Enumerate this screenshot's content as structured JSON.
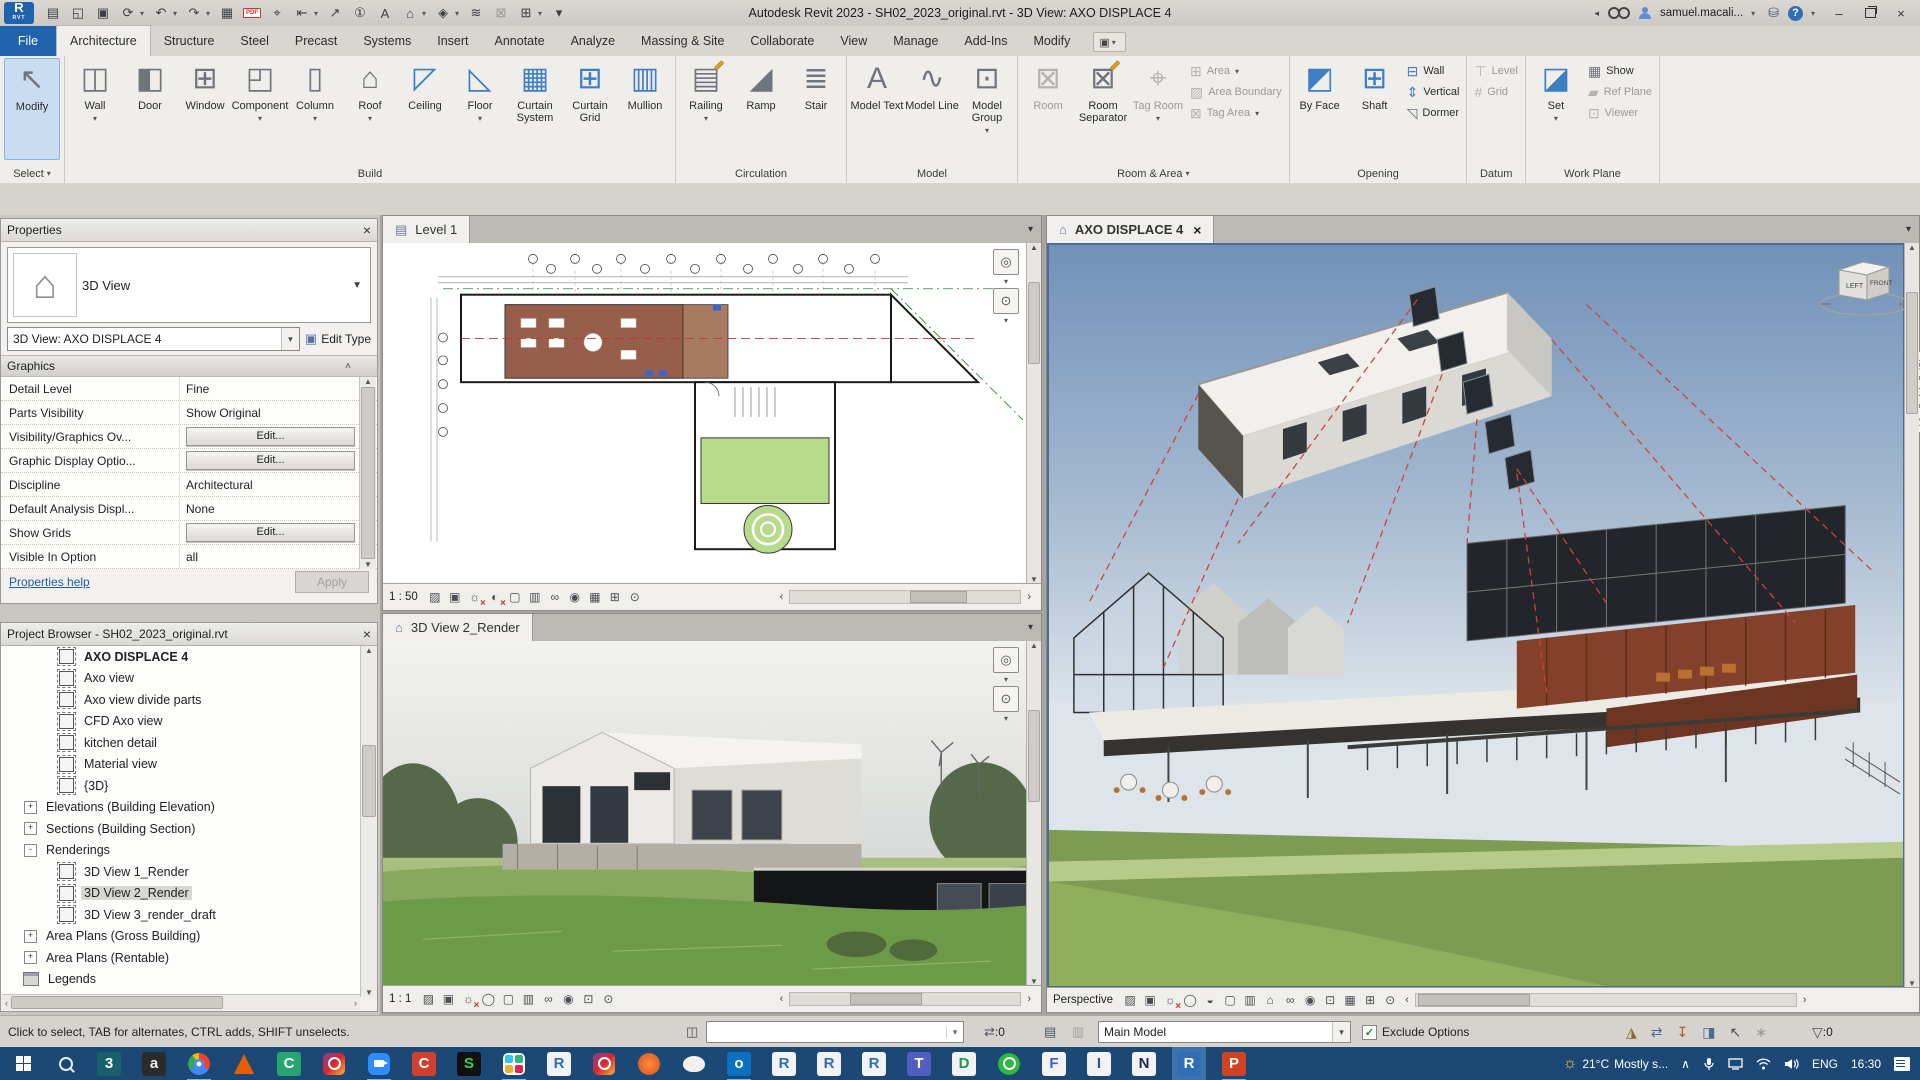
{
  "title_bar": {
    "title": "Autodesk Revit 2023 - SH02_2023_original.rvt - 3D View: AXO DISPLACE 4",
    "user": "samuel.macali...",
    "qat": [
      {
        "n": "file-properties-icon",
        "g": "▤"
      },
      {
        "n": "open-file-icon",
        "g": "◱"
      },
      {
        "n": "save-icon",
        "g": "▣"
      },
      {
        "n": "sync-with-central-icon",
        "g": "⟳",
        "a": 1
      },
      {
        "n": "undo-icon",
        "g": "↶",
        "a": 1
      },
      {
        "n": "redo-icon",
        "g": "↷",
        "a": 1
      },
      {
        "n": "print-icon",
        "g": "▦"
      },
      {
        "n": "export-pdf-icon",
        "g": "PDF",
        "pdf": 1
      },
      {
        "n": "measure-icon",
        "g": "⌖"
      },
      {
        "n": "aligned-dimension-icon",
        "g": "⇤",
        "a": 1
      },
      {
        "n": "detail-line-icon",
        "g": "↗"
      },
      {
        "n": "tag-by-category-icon",
        "g": "①"
      },
      {
        "n": "text-icon",
        "g": "A"
      },
      {
        "n": "default-3d-view-icon",
        "g": "⌂",
        "a": 1
      },
      {
        "n": "section-icon",
        "g": "◈",
        "a": 1
      },
      {
        "n": "thin-lines-icon",
        "g": "≋"
      },
      {
        "n": "close-inactive-windows-icon",
        "g": "⊠",
        "dis": 1
      },
      {
        "n": "switch-windows-icon",
        "g": "⊞",
        "a": 1
      },
      {
        "n": "customize-qat-icon",
        "g": "▾"
      }
    ]
  },
  "tabs": {
    "items": [
      "File",
      "Architecture",
      "Structure",
      "Steel",
      "Precast",
      "Systems",
      "Insert",
      "Annotate",
      "Analyze",
      "Massing & Site",
      "Collaborate",
      "View",
      "Manage",
      "Add-Ins",
      "Modify"
    ],
    "active_index": 1
  },
  "ribbon": {
    "select": {
      "modify": "Modify",
      "label": "Select"
    },
    "panels": [
      {
        "name": "Build",
        "buttons": [
          {
            "l": "Wall",
            "g": "◫",
            "a": 1
          },
          {
            "l": "Door",
            "g": "◧"
          },
          {
            "l": "Window",
            "g": "⊞"
          },
          {
            "l": "Component",
            "g": "◰",
            "a": 1
          },
          {
            "l": "Column",
            "g": "▯",
            "a": 1
          },
          {
            "l": "Roof",
            "g": "⌂",
            "a": 1
          },
          {
            "l": "Ceiling",
            "g": "◸",
            "blu": 1
          },
          {
            "l": "Floor",
            "g": "◺",
            "a": 1,
            "blu": 1
          },
          {
            "l": "Curtain System",
            "g": "▦",
            "blu": 1
          },
          {
            "l": "Curtain Grid",
            "g": "⊞",
            "blu": 1
          },
          {
            "l": "Mullion",
            "g": "▥",
            "blu": 1
          }
        ]
      },
      {
        "name": "Circulation",
        "buttons": [
          {
            "l": "Railing",
            "g": "▤",
            "a": 1,
            "pen": 1
          },
          {
            "l": "Ramp",
            "g": "◢"
          },
          {
            "l": "Stair",
            "g": "≣"
          }
        ]
      },
      {
        "name": "Model",
        "buttons": [
          {
            "l": "Model Text",
            "g": "A"
          },
          {
            "l": "Model Line",
            "g": "∿"
          },
          {
            "l": "Model Group",
            "g": "⊡",
            "a": 1
          }
        ]
      },
      {
        "name": "Room & Area",
        "arrow": 1,
        "buttons": [
          {
            "l": "Room",
            "g": "⊠",
            "dis": 1
          },
          {
            "l": "Room Separator",
            "g": "⊠",
            "pen": 1
          },
          {
            "l": "Tag Room",
            "g": "⌖",
            "dis": 1,
            "a": 1
          },
          {
            "l": "Area",
            "g": "⊞",
            "dis": 1,
            "a": 1,
            "s": 1
          },
          {
            "l": "Area Boundary",
            "g": "▨",
            "dis": 1,
            "s": 1
          },
          {
            "l": "Tag Area",
            "g": "⊠",
            "dis": 1,
            "a": 1,
            "s": 1
          }
        ]
      },
      {
        "name": "Opening",
        "buttons": [
          {
            "l": "By Face",
            "g": "◩",
            "blu": 1
          },
          {
            "l": "Shaft",
            "g": "⊞",
            "blu": 1
          },
          {
            "l": "Wall",
            "g": "⊟",
            "blu": 1,
            "s": 1
          },
          {
            "l": "Vertical",
            "g": "⇕",
            "blu": 1,
            "s": 1
          },
          {
            "l": "Dormer",
            "g": "◹",
            "s": 1
          }
        ]
      },
      {
        "name": "Datum",
        "buttons": [
          {
            "l": "Level",
            "g": "⊤",
            "dis": 1,
            "s": 1
          },
          {
            "l": "Grid",
            "g": "#",
            "dis": 1,
            "s": 1
          }
        ]
      },
      {
        "name": "Work Plane",
        "buttons": [
          {
            "l": "Set",
            "g": "◪",
            "a": 1,
            "blu": 1
          },
          {
            "l": "Show",
            "g": "▦",
            "s": 1
          },
          {
            "l": "Ref Plane",
            "g": "▰",
            "dis": 1,
            "s": 1
          },
          {
            "l": "Viewer",
            "g": "⊡",
            "dis": 1,
            "s": 1
          }
        ]
      }
    ]
  },
  "properties": {
    "header": "Properties",
    "type_name": "3D View",
    "instance": "3D View: AXO DISPLACE 4",
    "edit_type": "Edit Type",
    "section": "Graphics",
    "rows": [
      {
        "label": "Detail Level",
        "value": "Fine"
      },
      {
        "label": "Parts Visibility",
        "value": "Show Original"
      },
      {
        "label": "Visibility/Graphics Ov...",
        "value": "Edit...",
        "btn": 1
      },
      {
        "label": "Graphic Display Optio...",
        "value": "Edit...",
        "btn": 1
      },
      {
        "label": "Discipline",
        "value": "Architectural"
      },
      {
        "label": "Default Analysis Displ...",
        "value": "None"
      },
      {
        "label": "Show Grids",
        "value": "Edit...",
        "btn": 1
      },
      {
        "label": "Visible In Option",
        "value": "all"
      }
    ],
    "help": "Properties help",
    "apply": "Apply"
  },
  "project_browser": {
    "header": "Project Browser - SH02_2023_original.rvt",
    "items": [
      {
        "label": "AXO DISPLACE 4",
        "t": "view",
        "bold": 1
      },
      {
        "label": "Axo view",
        "t": "view"
      },
      {
        "label": "Axo view divide parts",
        "t": "view"
      },
      {
        "label": "CFD Axo view",
        "t": "view"
      },
      {
        "label": "kitchen detail",
        "t": "view"
      },
      {
        "label": "Material view",
        "t": "view"
      },
      {
        "label": "{3D}",
        "t": "view"
      },
      {
        "label": "Elevations (Building Elevation)",
        "t": "cat",
        "exp": "+"
      },
      {
        "label": "Sections (Building Section)",
        "t": "cat",
        "exp": "+"
      },
      {
        "label": "Renderings",
        "t": "cat",
        "exp": "-"
      },
      {
        "label": "3D View 1_Render",
        "t": "view"
      },
      {
        "label": "3D View 2_Render",
        "t": "view",
        "sel": 1
      },
      {
        "label": "3D View 3_render_draft",
        "t": "view"
      },
      {
        "label": "Area Plans (Gross Building)",
        "t": "cat",
        "exp": "+"
      },
      {
        "label": "Area Plans (Rentable)",
        "t": "cat",
        "exp": "+"
      },
      {
        "label": "Legends",
        "t": "leg"
      }
    ]
  },
  "views": {
    "plan": {
      "tab": "Level 1",
      "scale": "1 : 50",
      "vcb": [
        {
          "n": "detail-level-icon",
          "g": "▨"
        },
        {
          "n": "visual-style-icon",
          "g": "▣"
        },
        {
          "n": "sun-path-icon",
          "g": "☼",
          "off": 1
        },
        {
          "n": "shadows-icon",
          "g": "◐",
          "off": 1
        },
        {
          "n": "crop-view-icon",
          "g": "▢"
        },
        {
          "n": "show-crop-region-icon",
          "g": "▥"
        },
        {
          "n": "temporary-hide-isolate-icon",
          "g": "∞"
        },
        {
          "n": "reveal-hidden-elements-icon",
          "g": "◉"
        },
        {
          "n": "temporary-view-properties-icon",
          "g": "▦"
        },
        {
          "n": "worksharing-display-icon",
          "g": "⊞"
        },
        {
          "n": "reveal-constraints-icon",
          "g": "⊙"
        }
      ]
    },
    "render": {
      "tab": "3D View 2_Render",
      "scale": "1 : 1",
      "vcb": [
        {
          "n": "detail-level-icon",
          "g": "▨"
        },
        {
          "n": "visual-style-icon",
          "g": "▣"
        },
        {
          "n": "sun-path-icon",
          "g": "☼",
          "off": 1
        },
        {
          "n": "render-icon",
          "g": "◯"
        },
        {
          "n": "crop-view-icon",
          "g": "▢"
        },
        {
          "n": "show-crop-region-icon",
          "g": "▥"
        },
        {
          "n": "temporary-hide-isolate-icon",
          "g": "∞"
        },
        {
          "n": "reveal-hidden-elements-icon",
          "g": "◉"
        },
        {
          "n": "temporary-view-properties-icon",
          "g": "⊡"
        },
        {
          "n": "reveal-constraints-icon",
          "g": "⊙"
        }
      ]
    },
    "axo": {
      "tab": "AXO DISPLACE 4",
      "mode": "Perspective",
      "viewcube_left": "LEFT",
      "viewcube_front": "FRONT",
      "vcb": [
        {
          "n": "detail-level-icon",
          "g": "▨"
        },
        {
          "n": "visual-style-icon",
          "g": "▣"
        },
        {
          "n": "sun-path-icon",
          "g": "☼",
          "off": 1
        },
        {
          "n": "render-icon",
          "g": "◯"
        },
        {
          "n": "render-gallery-icon",
          "g": "◒"
        },
        {
          "n": "crop-view-icon",
          "g": "▢"
        },
        {
          "n": "show-crop-region-icon",
          "g": "▥"
        },
        {
          "n": "save-orientation-icon",
          "g": "⌂"
        },
        {
          "n": "temporary-hide-isolate-icon",
          "g": "∞"
        },
        {
          "n": "reveal-hidden-elements-icon",
          "g": "◉"
        },
        {
          "n": "temporary-view-properties-icon",
          "g": "⊡"
        },
        {
          "n": "worksharing-display-icon",
          "g": "▦"
        },
        {
          "n": "displaced-elements-icon",
          "g": "⊞"
        },
        {
          "n": "reveal-constraints-icon",
          "g": "⊙"
        }
      ]
    }
  },
  "status_bar": {
    "hint": "Click to select, TAB for alternates, CTRL adds, SHIFT unselects.",
    "editing_requests": ":0",
    "design_option": "Main Model",
    "exclude_options": "Exclude Options",
    "selection_count": ":0"
  },
  "taskbar": {
    "apps": [
      {
        "n": "app-3ds-max",
        "k": "sq",
        "l": "3",
        "bg": "#16616b",
        "fg": "#ffffff"
      },
      {
        "n": "app-dark-a",
        "k": "sq",
        "l": "a",
        "bg": "#2b2b2b",
        "fg": "#eeeeee"
      },
      {
        "n": "app-chrome",
        "k": "chrome",
        "running": 1
      },
      {
        "n": "app-vlc",
        "k": "vlc"
      },
      {
        "n": "app-camtasia",
        "k": "sq",
        "l": "C",
        "bg": "#27a56f",
        "fg": "#ffffff"
      },
      {
        "n": "app-clipchamp",
        "k": "grad"
      },
      {
        "n": "app-zoom",
        "k": "zoom",
        "running": 1
      },
      {
        "n": "app-ccleaner",
        "k": "sq",
        "l": "C",
        "bg": "#d33f2e",
        "fg": "#ffffff"
      },
      {
        "n": "app-s-black",
        "k": "sq",
        "l": "S",
        "bg": "#101010",
        "fg": "#39d353"
      },
      {
        "n": "app-slack",
        "k": "slack",
        "running": 1
      },
      {
        "n": "app-revit-white",
        "k": "sq",
        "l": "R",
        "bg": "#f2f2f2",
        "fg": "#2f6eb5"
      },
      {
        "n": "app-photos",
        "k": "grad"
      },
      {
        "n": "app-orange",
        "k": "orange"
      },
      {
        "n": "app-rhino",
        "k": "rhino"
      },
      {
        "n": "app-outlook",
        "k": "sq",
        "l": "o",
        "bg": "#0b6fc2",
        "fg": "#ffffff",
        "running": 1
      },
      {
        "n": "app-revit-2",
        "k": "sq",
        "l": "R",
        "bg": "#f2f2f2",
        "fg": "#2f6eb5"
      },
      {
        "n": "app-revit-3",
        "k": "sq",
        "l": "R",
        "bg": "#f2f2f2",
        "fg": "#2f6eb5"
      },
      {
        "n": "app-revit-4",
        "k": "sq",
        "l": "R",
        "bg": "#f2f2f2",
        "fg": "#2f6eb5"
      },
      {
        "n": "app-teams",
        "k": "sq",
        "l": "T",
        "bg": "#4e5fbf",
        "fg": "#ffffff"
      },
      {
        "n": "app-d-green",
        "k": "sq",
        "l": "D",
        "bg": "#f2f2f2",
        "fg": "#1a9850"
      },
      {
        "n": "app-whatsapp",
        "k": "wa"
      },
      {
        "n": "app-f-blue",
        "k": "sq",
        "l": "F",
        "bg": "#f2f2f2",
        "fg": "#3b5fd0"
      },
      {
        "n": "app-i-blue",
        "k": "sq",
        "l": "I",
        "bg": "#f2f2f2",
        "fg": "#2b4fa0"
      },
      {
        "n": "app-n-navy",
        "k": "sq",
        "l": "N",
        "bg": "#f2f2f2",
        "fg": "#1b2a5e"
      },
      {
        "n": "app-revit-active",
        "k": "sq",
        "l": "R",
        "bg": "#2f6eb5",
        "fg": "#ffffff",
        "active": 1,
        "running": 1
      },
      {
        "n": "app-powerpoint",
        "k": "sq",
        "l": "P",
        "bg": "#d14423",
        "fg": "#ffffff",
        "running": 1
      }
    ],
    "tray": {
      "temp": "21°C",
      "weather": "Mostly s...",
      "lang": "ENG",
      "time": "16:30"
    }
  }
}
